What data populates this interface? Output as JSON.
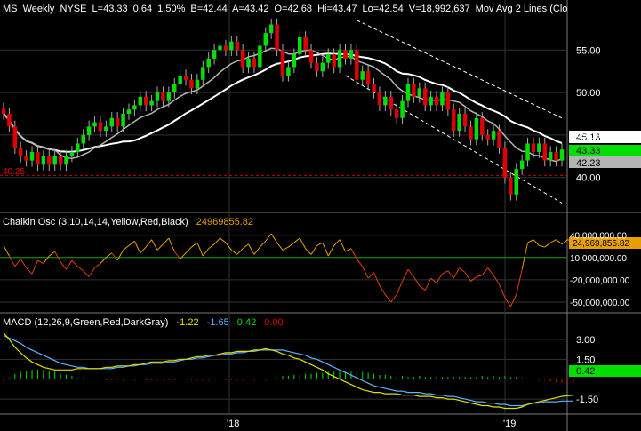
{
  "window": {
    "price_header": {
      "symbol": "MS",
      "interval": "Weekly",
      "exchange": "NYSE",
      "last": "L=43.33",
      "change": "0.64",
      "change_pct": "1.50%",
      "bid": "B=42.44",
      "ask": "A=43.42",
      "open": "O=42.68",
      "high": "Hi=43.47",
      "low": "Lo=42.54",
      "volume": "V=18,992,637",
      "study": "Mov Avg 2 Lines (Clo"
    },
    "chaikin_header": {
      "label": "Chaikin Osc (3,10,14,14,Yellow,Red,Black)",
      "value": "24969855.82"
    },
    "macd_header": {
      "label": "MACD (12,26,9,Green,Red,DarkGray)",
      "v1": "-1.22",
      "v2": "-1.65",
      "v3": "0.42",
      "v4": "0.00"
    },
    "price_tags": {
      "ma": "45.13",
      "last": "43.33",
      "ma2": "42.23",
      "support": "40.25"
    },
    "chaikin_tag": "24,969,855.82",
    "macd_tag": "0.42",
    "date_labels": {
      "a": "'18",
      "b": "'19"
    },
    "colors": {
      "up": "#00e000",
      "down": "#e00000",
      "ma_fast": "#b4b4b4",
      "ma_slow": "#ffffff",
      "chaikin": "#e8a000",
      "macd": "#5ab4ff",
      "signal": "#e0e000",
      "grid": "#333333",
      "support": "#c00000",
      "trend": "#ffffff"
    }
  },
  "chart_data": [
    {
      "type": "candlestick",
      "title": "MS - Weekly NYSE",
      "ylim": [
        36,
        59
      ],
      "y_ticks": [
        40,
        45,
        50,
        55
      ],
      "support_level": 40.25,
      "x_labels": [
        "'18",
        "'19"
      ],
      "closes": [
        47.5,
        46,
        43.5,
        42.5,
        42,
        43,
        41.5,
        42.5,
        41.5,
        42.5,
        41.5,
        42.5,
        43,
        44,
        45,
        46,
        46.5,
        45.5,
        46,
        47,
        46,
        47.5,
        48,
        48.5,
        49.5,
        48.5,
        49,
        50,
        49,
        50,
        51,
        52,
        51.5,
        50.5,
        51.5,
        53,
        54,
        55,
        55.5,
        55,
        56,
        55,
        53,
        54,
        53,
        55.5,
        57,
        58,
        55,
        52,
        53,
        54.5,
        56.5,
        55,
        53.5,
        52.5,
        53.5,
        54.5,
        53,
        55,
        54,
        55,
        51.5,
        52.5,
        51,
        50,
        48.5,
        49.5,
        48,
        47,
        49,
        51,
        49.5,
        50.5,
        48.5,
        49.5,
        48.5,
        50,
        48,
        45.5,
        47.5,
        46,
        44.5,
        47,
        45,
        44.5,
        45.5,
        43.5,
        40,
        38,
        41,
        42,
        44,
        43,
        44,
        42,
        43,
        42,
        43.3
      ],
      "ma_fast_label": "45.13",
      "ma_slow_label": "42.23",
      "last_label": "43.33"
    },
    {
      "type": "line",
      "title": "Chaikin Osc (3,10,14,14,Yellow,Red,Black)",
      "ylim": [
        -62000000,
        48000000
      ],
      "y_ticks": [
        40000000,
        10000000,
        -20000000,
        -50000000
      ],
      "y_tick_labels": [
        "40,000,000.00",
        "10,000,000.00",
        "-20,000,000.00",
        "-50,000,000.00"
      ],
      "values": [
        26,
        12,
        -2,
        8,
        -4,
        -12,
        6,
        2,
        12,
        18,
        4,
        -6,
        6,
        -2,
        -8,
        -16,
        -4,
        2,
        10,
        16,
        6,
        20,
        26,
        32,
        16,
        24,
        34,
        20,
        28,
        36,
        18,
        8,
        16,
        24,
        30,
        12,
        22,
        28,
        36,
        30,
        20,
        14,
        22,
        28,
        14,
        24,
        32,
        42,
        30,
        20,
        24,
        30,
        36,
        22,
        14,
        26,
        30,
        12,
        26,
        34,
        18,
        22,
        8,
        -2,
        -18,
        -10,
        -28,
        -40,
        -50,
        -40,
        -22,
        -6,
        -16,
        -28,
        -34,
        -18,
        -24,
        -12,
        -8,
        -18,
        -4,
        -10,
        -22,
        -16,
        -14,
        -4,
        -14,
        -26,
        -44,
        -56,
        -40,
        -6,
        30,
        34,
        26,
        24,
        30,
        34,
        28,
        34,
        32,
        25
      ]
    },
    {
      "type": "line",
      "title": "MACD (12,26,9,Green,Red,DarkGray)",
      "ylim": [
        -2.5,
        3.8
      ],
      "y_ticks": [
        3.0,
        1.5,
        -1.5
      ],
      "y_tick_labels": [
        "3.00",
        "1.50",
        "-1.50"
      ],
      "series": [
        {
          "name": "MACD",
          "values": [
            3.3,
            3.1,
            2.9,
            2.7,
            2.4,
            2.2,
            2.0,
            1.8,
            1.6,
            1.4,
            1.2,
            1.1,
            1.0,
            0.9,
            0.9,
            0.8,
            0.8,
            0.8,
            0.8,
            0.8,
            0.9,
            0.9,
            1.0,
            1.0,
            1.1,
            1.1,
            1.2,
            1.2,
            1.2,
            1.3,
            1.3,
            1.4,
            1.5,
            1.5,
            1.6,
            1.6,
            1.7,
            1.8,
            1.8,
            1.9,
            1.9,
            2.0,
            2.0,
            2.1,
            2.1,
            2.2,
            2.2,
            2.2,
            2.2,
            2.2,
            2.1,
            2.0,
            1.9,
            1.8,
            1.6,
            1.5,
            1.3,
            1.1,
            0.9,
            0.7,
            0.5,
            0.3,
            0.1,
            -0.1,
            -0.3,
            -0.5,
            -0.6,
            -0.7,
            -0.8,
            -0.9,
            -0.9,
            -1.0,
            -1.0,
            -1.0,
            -1.1,
            -1.1,
            -1.2,
            -1.2,
            -1.3,
            -1.3,
            -1.4,
            -1.5,
            -1.6,
            -1.7,
            -1.7,
            -1.8,
            -1.8,
            -1.9,
            -1.9,
            -2.0,
            -2.0,
            -2.0,
            -1.9,
            -1.8,
            -1.8,
            -1.7,
            -1.7,
            -1.7,
            -1.65,
            -1.65,
            -1.65
          ]
        },
        {
          "name": "Signal",
          "values": [
            3.5,
            3.0,
            2.4,
            2.0,
            1.6,
            1.3,
            1.1,
            0.9,
            0.8,
            0.7,
            0.7,
            0.7,
            0.7,
            0.8,
            0.8,
            0.8,
            0.8,
            0.8,
            0.9,
            0.9,
            1.0,
            1.0,
            1.0,
            1.1,
            1.1,
            1.2,
            1.3,
            1.3,
            1.3,
            1.4,
            1.4,
            1.5,
            1.5,
            1.6,
            1.7,
            1.7,
            1.8,
            1.8,
            1.9,
            2.0,
            2.0,
            2.1,
            2.1,
            2.1,
            2.2,
            2.2,
            2.3,
            2.2,
            2.1,
            1.9,
            1.8,
            1.6,
            1.5,
            1.3,
            1.1,
            0.9,
            0.7,
            0.4,
            0.2,
            0.0,
            -0.2,
            -0.4,
            -0.6,
            -0.8,
            -0.9,
            -1.0,
            -1.0,
            -1.1,
            -1.1,
            -1.1,
            -1.2,
            -1.2,
            -1.2,
            -1.3,
            -1.3,
            -1.3,
            -1.4,
            -1.4,
            -1.5,
            -1.5,
            -1.6,
            -1.7,
            -1.8,
            -1.9,
            -2.0,
            -2.0,
            -2.1,
            -2.1,
            -2.2,
            -2.2,
            -2.2,
            -2.1,
            -1.9,
            -1.8,
            -1.7,
            -1.6,
            -1.5,
            -1.4,
            -1.3,
            -1.25,
            -1.22
          ]
        }
      ]
    }
  ]
}
